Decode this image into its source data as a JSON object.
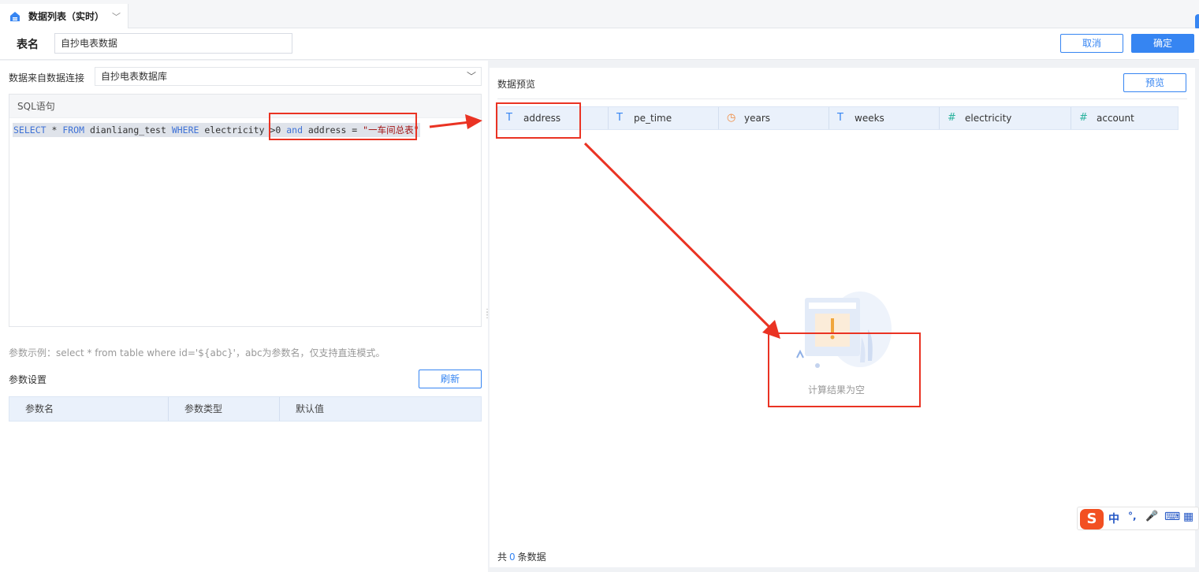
{
  "tab": {
    "title": "数据列表（实时）",
    "chevron": "chevron-down-icon"
  },
  "header": {
    "table_name_label": "表名",
    "table_name_value": "自抄电表数据",
    "cancel_label": "取消",
    "confirm_label": "确定"
  },
  "left": {
    "source_label": "数据来自数据连接",
    "source_value": "自抄电表数据库",
    "sql_title": "SQL语句",
    "sql": {
      "kw_select": "SELECT",
      "p1": " * ",
      "kw_from": "FROM",
      "p2": " dianliang_test ",
      "kw_where": "WHERE",
      "p3": " electricity >0 ",
      "kw_and": "and",
      "p4": " address = ",
      "str": "\"一车间总表\""
    },
    "hint": "参数示例：select * from table where id='${abc}'，abc为参数名，仅支持直连模式。",
    "params_title": "参数设置",
    "refresh_label": "刷新",
    "param_columns": [
      "参数名",
      "参数类型",
      "默认值"
    ]
  },
  "right": {
    "title": "数据预览",
    "preview_label": "预览",
    "columns": [
      {
        "name": "address",
        "icon": "T"
      },
      {
        "name": "pe_time",
        "icon": "T"
      },
      {
        "name": "years",
        "icon": "⏱"
      },
      {
        "name": "weeks",
        "icon": "T"
      },
      {
        "name": "electricity",
        "icon": "#"
      },
      {
        "name": "account",
        "icon": "#"
      }
    ],
    "empty_text": "计算结果为空",
    "count_prefix": "共",
    "count_value": "0",
    "count_suffix": "条数据"
  },
  "ime": {
    "logo": "S",
    "items": [
      "中",
      "°,",
      "🎤",
      "⌨",
      "▦"
    ]
  },
  "colors": {
    "accent": "#3685f2",
    "annotation_red": "#ea3323",
    "header_bg": "#eaf1fb"
  }
}
